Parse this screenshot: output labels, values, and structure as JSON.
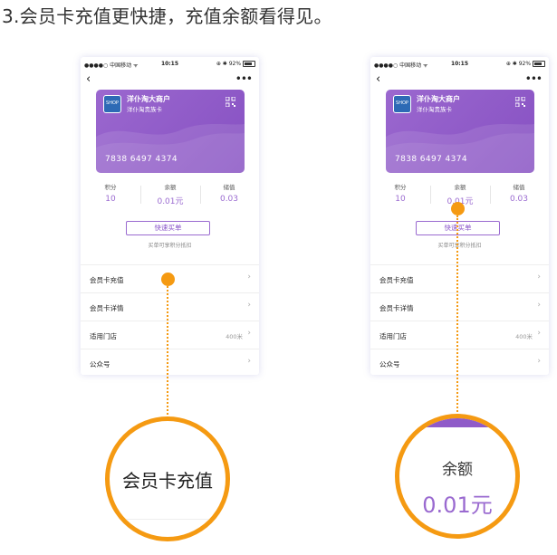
{
  "headline": "3.会员卡充值更快捷，充值余额看得见。",
  "phone": {
    "status_left": "●●●●○ 中国移动 ᯤ",
    "status_time": "10:15",
    "status_right": "⊕ ✱ 92%",
    "back_icon": "‹",
    "more_icon": "•••",
    "card": {
      "logo_text": "SHOP",
      "merchant": "洋仆淘大商户",
      "card_name": "洋仆淘贵族卡",
      "card_number": "7838  6497  4374"
    },
    "stats": [
      {
        "label": "积分",
        "value": "10"
      },
      {
        "label": "余额",
        "value": "0.01元"
      },
      {
        "label": "储值",
        "value": "0.03"
      }
    ],
    "quick_button": "快速买单",
    "quick_hint": "买单可享积分抵扣",
    "menu": [
      {
        "label": "会员卡充值",
        "detail": ""
      },
      {
        "label": "会员卡详情",
        "detail": ""
      },
      {
        "label": "适用门店",
        "detail": "400米"
      },
      {
        "label": "公众号",
        "detail": ""
      }
    ],
    "chevron": "›"
  },
  "zoom_left": {
    "text": "会员卡充值"
  },
  "zoom_right": {
    "label": "余额",
    "value": "0.01元"
  },
  "colors": {
    "accent": "#9a6ad0",
    "card": "#8b55c5",
    "highlight": "#f59a12"
  }
}
